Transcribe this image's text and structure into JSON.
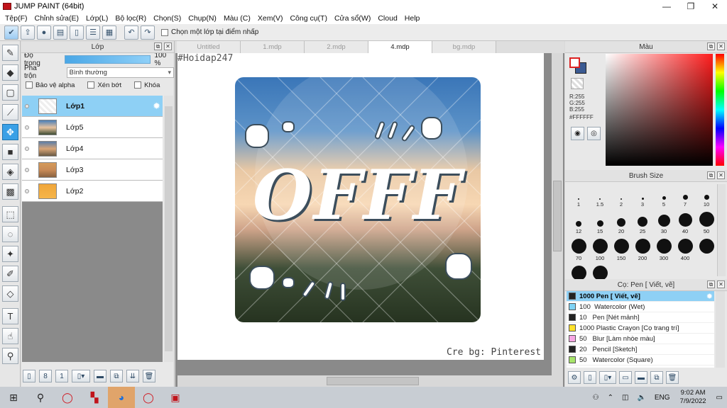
{
  "window": {
    "title": "JUMP PAINT (64bit)"
  },
  "menu": [
    "Tệp(F)",
    "Chỉnh sửa(E)",
    "Lớp(L)",
    "Bộ lọc(R)",
    "Chọn(S)",
    "Chụp(N)",
    "Màu (C)",
    "Xem(V)",
    "Công cụ(T)",
    "Cửa sổ(W)",
    "Cloud",
    "Help"
  ],
  "toolbar": {
    "checkbox_label": "Chọn một lớp tại điểm nhấp"
  },
  "layer_panel": {
    "title": "Lớp",
    "opacity_label": "Độ trong",
    "opacity_value": "100 %",
    "opacity_fraction": 1.0,
    "blend_label": "Pha trộn",
    "blend_value": "Bình thường",
    "flags": [
      "Bảo vệ alpha",
      "Xén bớt",
      "Khóa"
    ],
    "layers": [
      {
        "name": "Lớp1",
        "selected": true
      },
      {
        "name": "Lớp5",
        "selected": false
      },
      {
        "name": "Lớp4",
        "selected": false
      },
      {
        "name": "Lớp3",
        "selected": false
      },
      {
        "name": "Lớp2",
        "selected": false
      }
    ]
  },
  "doc_tabs": [
    {
      "label": "Untitled",
      "active": false
    },
    {
      "label": "1.mdp",
      "active": false
    },
    {
      "label": "2.mdp",
      "active": false
    },
    {
      "label": "4.mdp",
      "active": true
    },
    {
      "label": "bg.mdp",
      "active": false
    }
  ],
  "canvas": {
    "watermark": "#Hoidap247",
    "credit": "Cre bg: Pinterest",
    "art_text": "OFFF"
  },
  "color_panel": {
    "title": "Màu",
    "r": "R:255",
    "g": "G:255",
    "b": "B:255",
    "hex": "#FFFFFF",
    "fg_color": "#FFFFFF",
    "bg_color": "#3B5A92"
  },
  "brush_size": {
    "title": "Brush Size",
    "sizes": [
      "1",
      "1.5",
      "2",
      "3",
      "5",
      "7",
      "10",
      "12",
      "15",
      "20",
      "25",
      "30",
      "40",
      "50",
      "70",
      "100",
      "150",
      "200",
      "300",
      "400",
      "",
      "",
      ""
    ]
  },
  "brushes": {
    "title": "Cọ: Pen [ Viết, vẽ]",
    "items": [
      {
        "size": "1000",
        "name": "Pen [ Viết, vẽ]",
        "color": "#222222",
        "selected": true
      },
      {
        "size": "100",
        "name": "Watercolor (Wet)",
        "color": "#7fd3f5",
        "selected": false
      },
      {
        "size": "10",
        "name": "Pen [Nét mảnh]",
        "color": "#222222",
        "selected": false
      },
      {
        "size": "1000",
        "name": "Plastic Crayon [Cọ trang trí]",
        "color": "#ffe12a",
        "selected": false
      },
      {
        "size": "50",
        "name": "Blur [Làm nhòe màu]",
        "color": "#f7a7e4",
        "selected": false
      },
      {
        "size": "20",
        "name": "Pencil [Sketch]",
        "color": "#222222",
        "selected": false
      },
      {
        "size": "50",
        "name": "Watercolor (Square)",
        "color": "#a7e46a",
        "selected": false
      }
    ]
  },
  "taskbar": {
    "lang": "ENG",
    "time": "9:02 AM",
    "date": "7/9/2022"
  }
}
